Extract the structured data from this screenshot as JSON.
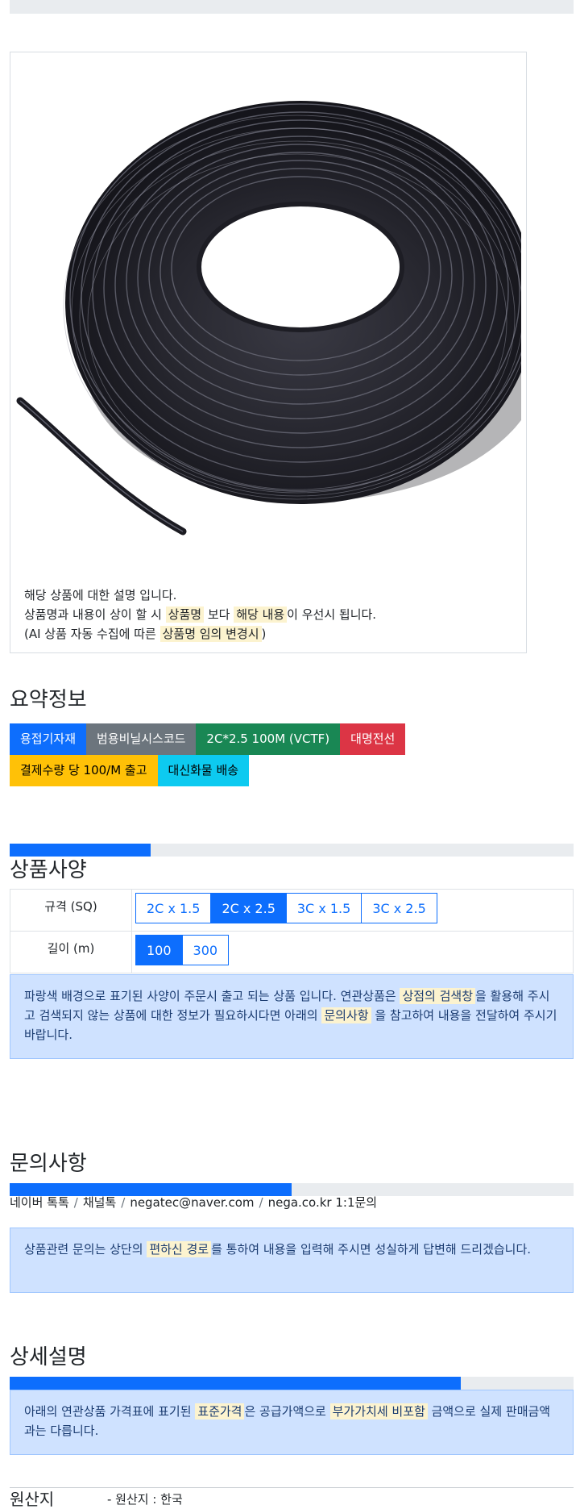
{
  "description": {
    "line1": "해당 상품에 대한 설명 입니다.",
    "line2_pre": "상품명과 내용이 상이 할 시 ",
    "line2_mark1": "상품명",
    "line2_mid": " 보다 ",
    "line2_mark2": "해당 내용",
    "line2_post": "이 우선시 됩니다.",
    "line3_pre": "(AI 상품 자동 수집에 따른 ",
    "line3_mark": "상품명 임의 변경시",
    "line3_post": ")"
  },
  "summary": {
    "title": "요약정보",
    "badges": [
      "용접기자재",
      "범용비닐시스코드",
      "2C*2.5 100M (VCTF)",
      "대명전선",
      "결제수량 당 100/M 출고",
      "대신화물 배송"
    ],
    "badge_colors": [
      "#0d6efd",
      "#6c757d",
      "#198754",
      "#dc3545",
      "#ffc107",
      "#0dcaf0"
    ]
  },
  "spec": {
    "title": "상품사양",
    "progress": 0.25,
    "rows": [
      {
        "label": "규격 (SQ)",
        "options": [
          "2C x 1.5",
          "2C x 2.5",
          "3C x 1.5",
          "3C x 2.5"
        ],
        "selected": "2C x 2.5"
      },
      {
        "label": "길이 (m)",
        "options": [
          "100",
          "300"
        ],
        "selected": "100"
      }
    ],
    "note_pre": "파랑색 배경으로 표기된 사양이 주문시 출고 되는 상품 입니다. 연관상품은 ",
    "note_mark1": "상점의 검색창",
    "note_mid": "을 활용해 주시고 검색되지 않는 상품에 대한 정보가 필요하시다면 아래의 ",
    "note_mark2": "문의사항",
    "note_post": " 을 참고하여 내용을 전달하여 주시기 바랍니다."
  },
  "inquiry": {
    "title": "문의사항",
    "progress": 0.5,
    "contacts": [
      "네이버 톡톡",
      "채널톡",
      "negatec@naver.com",
      "nega.co.kr 1:1문의"
    ],
    "note_pre": "상품관련 문의는 상단의 ",
    "note_mark": "편하신 경로",
    "note_post": "를 통하여 내용을 입력해 주시면 성실하게 답변해 드리겠습니다."
  },
  "detail": {
    "title": "상세설명",
    "progress": 0.8,
    "note_pre": "아래의 연관상품 가격표에 표기된 ",
    "note_mark1": "표준가격",
    "note_mid": "은 공급가액으로 ",
    "note_mark2": "부가가치세 비포함",
    "note_post": " 금액으로 실제 판매금액과는 다릅니다."
  },
  "origin": {
    "label": "원산지",
    "value": "- 원산지 : 한국"
  }
}
